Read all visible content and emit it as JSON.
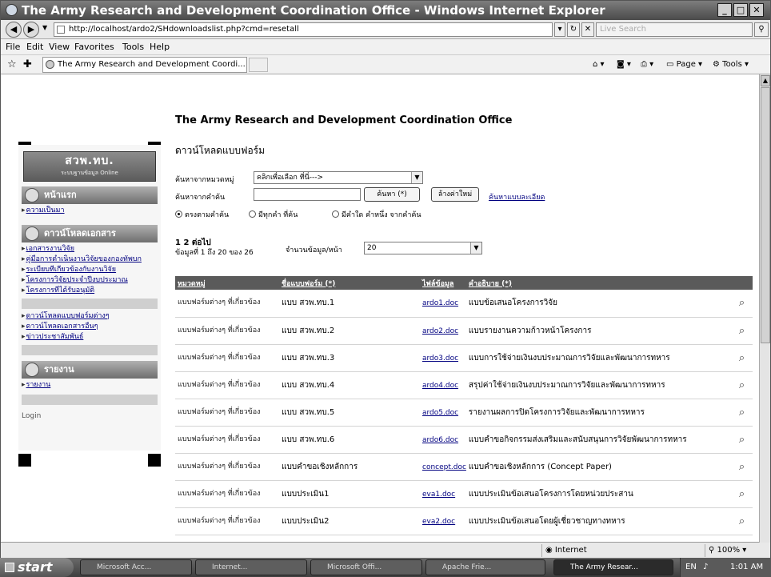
{
  "window": {
    "title": "The Army Research and Development Coordination Office - Windows Internet Explorer"
  },
  "browser": {
    "address": "http://localhost/ardo2/SHdownloadslist.php?cmd=resetall",
    "search_placeholder": "Live Search",
    "menu": [
      "File",
      "Edit",
      "View",
      "Favorites",
      "Tools",
      "Help"
    ],
    "tab_title": "The Army Research and Development Coordi...",
    "toolbar": {
      "page": "Page",
      "tools": "Tools"
    }
  },
  "sidebar": {
    "logo_text": "สวพ.ทบ.",
    "logo_sub": "ระบบฐานข้อมูล Online",
    "home_label": "หน้าแรก",
    "home_links": [
      "ความเป็นมา"
    ],
    "doc_section_label": "ดาวน์โหลดเอกสาร",
    "doc_links": [
      "เอกสารงานวิจัย",
      "คู่มือการดำเนินงานวิจัยของกองทัพบก",
      "ระเบียบที่เกี่ยวข้องกับงานวิจัย",
      "โครงการวิจัยประจำปีงบประมาณ",
      "โครงการที่ได้รับอนุมัติ"
    ],
    "doc_links_2": [
      "ดาวน์โหลดแบบฟอร์มต่างๆ",
      "ดาวน์โหลดเอกสารอื่นๆ",
      "ข่าวประชาสัมพันธ์"
    ],
    "report_section_label": "รายงาน",
    "report_links": [
      "รายงาน"
    ],
    "login_label": "Login"
  },
  "main": {
    "page_title": "The Army Research and Development Coordination Office",
    "heading": "ดาวน์โหลดแบบฟอร์ม",
    "search": {
      "cat_label": "ค้นหาจากหมวดหมู่",
      "cat_value": "คลิกเพื่อเลือก ที่นี่--->",
      "text_label": "ค้นหาจากคำค้น",
      "search_btn": "ค้นหา (*)",
      "reset_btn": "ล้างค่าใหม่",
      "advanced": "ค้นหาแบบละเอียด",
      "radio": [
        "ตรงตามคำค้น",
        "มีทุกคำ ที่ค้น",
        "มีคำใด คำหนึ่ง จากคำค้น"
      ]
    },
    "pager": {
      "pages": "1 2 ต่อไป",
      "records": "ข้อมูลที่ 1 ถึง 20 ของ 26",
      "per_page_label": "จำนวนข้อมูล/หน้า",
      "per_page_value": "20"
    },
    "table": {
      "headers": [
        "หมวดหมู่",
        "ชื่อแบบฟอร์ม (*)",
        "ไฟล์ข้อมูล",
        "คำอธิบาย (*)"
      ],
      "rows": [
        {
          "cat": "แบบฟอร์มต่างๆ ที่เกี่ยวข้อง",
          "name": "แบบ สวพ.ทบ.1",
          "file": "ardo1.doc",
          "desc": "แบบข้อเสนอโครงการวิจัย"
        },
        {
          "cat": "แบบฟอร์มต่างๆ ที่เกี่ยวข้อง",
          "name": "แบบ สวพ.ทบ.2",
          "file": "ardo2.doc",
          "desc": "แบบรายงานความก้าวหน้าโครงการ"
        },
        {
          "cat": "แบบฟอร์มต่างๆ ที่เกี่ยวข้อง",
          "name": "แบบ สวพ.ทบ.3",
          "file": "ardo3.doc",
          "desc": "แบบการใช้จ่ายเงินงบประมาณการวิจัยและพัฒนาการทหาร"
        },
        {
          "cat": "แบบฟอร์มต่างๆ ที่เกี่ยวข้อง",
          "name": "แบบ สวพ.ทบ.4",
          "file": "ardo4.doc",
          "desc": "สรุปค่าใช้จ่ายเงินงบประมาณการวิจัยและพัฒนาการทหาร"
        },
        {
          "cat": "แบบฟอร์มต่างๆ ที่เกี่ยวข้อง",
          "name": "แบบ สวพ.ทบ.5",
          "file": "ardo5.doc",
          "desc": "รายงานผลการปิดโครงการวิจัยและพัฒนาการทหาร"
        },
        {
          "cat": "แบบฟอร์มต่างๆ ที่เกี่ยวข้อง",
          "name": "แบบ สวพ.ทบ.6",
          "file": "ardo6.doc",
          "desc": "แบบคำขอกิจกรรมส่งเสริมและสนับสนุนการวิจัยพัฒนาการทหาร"
        },
        {
          "cat": "แบบฟอร์มต่างๆ ที่เกี่ยวข้อง",
          "name": "แบบคำขอเชิงหลักการ",
          "file": "concept.doc",
          "desc": "แบบคำขอเชิงหลักการ (Concept Paper)"
        },
        {
          "cat": "แบบฟอร์มต่างๆ ที่เกี่ยวข้อง",
          "name": "แบบประเมิน1",
          "file": "eva1.doc",
          "desc": "แบบประเมินข้อเสนอโครงการโดยหน่วยประสาน"
        },
        {
          "cat": "แบบฟอร์มต่างๆ ที่เกี่ยวข้อง",
          "name": "แบบประเมิน2",
          "file": "eva2.doc",
          "desc": "แบบประเมินข้อเสนอโดยผู้เชี่ยวชาญทางทหาร"
        }
      ]
    }
  },
  "status": {
    "zone": "Internet",
    "zoom": "100%"
  },
  "taskbar": {
    "start": "start",
    "tasks": [
      "Microsoft Acc...",
      "Internet...",
      "Microsoft Offi...",
      "Apache Frie...",
      "The Army Resear..."
    ],
    "lang": "EN",
    "time": "1:01 AM"
  }
}
